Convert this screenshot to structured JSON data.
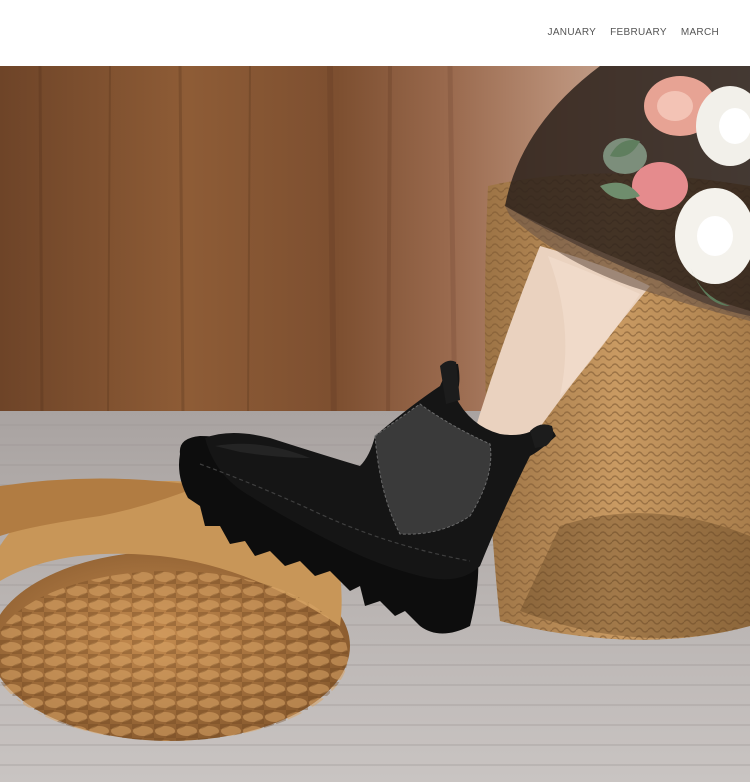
{
  "nav": {
    "items": [
      {
        "label": "JANUARY"
      },
      {
        "label": "FEBRUARY"
      },
      {
        "label": "MARCH"
      }
    ]
  },
  "colors": {
    "background": "#ffffff",
    "nav_text": "#555555",
    "wood_wall": "#8a5a35",
    "curtain": "#a06a52",
    "floor": "#b9b4b2",
    "wicker": "#b9844a",
    "boot": "#141414",
    "skin": "#e9cfbc",
    "sheer_fabric": "#4a3a30"
  },
  "photo": {
    "subject": "black suede chelsea boot",
    "icons": [
      "wicker-pouf-icon",
      "wicker-basket-icon",
      "flower-bouquet-icon",
      "boot-icon"
    ]
  }
}
